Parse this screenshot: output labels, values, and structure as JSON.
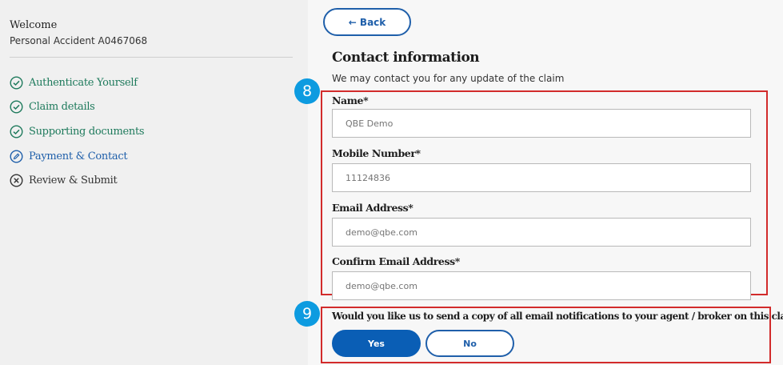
{
  "sidebar": {
    "welcome": "Welcome",
    "policy": "Personal Accident A0467068",
    "steps": [
      {
        "label": "Authenticate Yourself",
        "status": "done",
        "icon": "check-circle-icon"
      },
      {
        "label": "Claim details",
        "status": "done",
        "icon": "check-circle-icon"
      },
      {
        "label": "Supporting documents",
        "status": "done",
        "icon": "check-circle-icon"
      },
      {
        "label": "Payment & Contact",
        "status": "active",
        "icon": "pencil-circle-icon"
      },
      {
        "label": "Review & Submit",
        "status": "pending",
        "icon": "x-circle-icon"
      }
    ]
  },
  "main": {
    "back_label": "← Back",
    "title": "Contact information",
    "subtitle": "We may contact you for any update of the claim",
    "fields": [
      {
        "label": "Name*",
        "placeholder": "QBE Demo"
      },
      {
        "label": "Mobile Number*",
        "placeholder": "11124836"
      },
      {
        "label": "Email Address*",
        "placeholder": "demo@qbe.com"
      },
      {
        "label": "Confirm Email Address*",
        "placeholder": "demo@qbe.com"
      }
    ],
    "question": "Would you like us to send a copy of all email notifications to your agent / broker on this claim?*",
    "yes_label": "Yes",
    "no_label": "No"
  },
  "annotations": {
    "badge_8": "8",
    "badge_9": "9"
  },
  "colors": {
    "done": "#1e7a5c",
    "active": "#1f5faa",
    "highlight": "#d22b2b",
    "badge": "#0d9be0",
    "primary": "#0a5eb5"
  }
}
